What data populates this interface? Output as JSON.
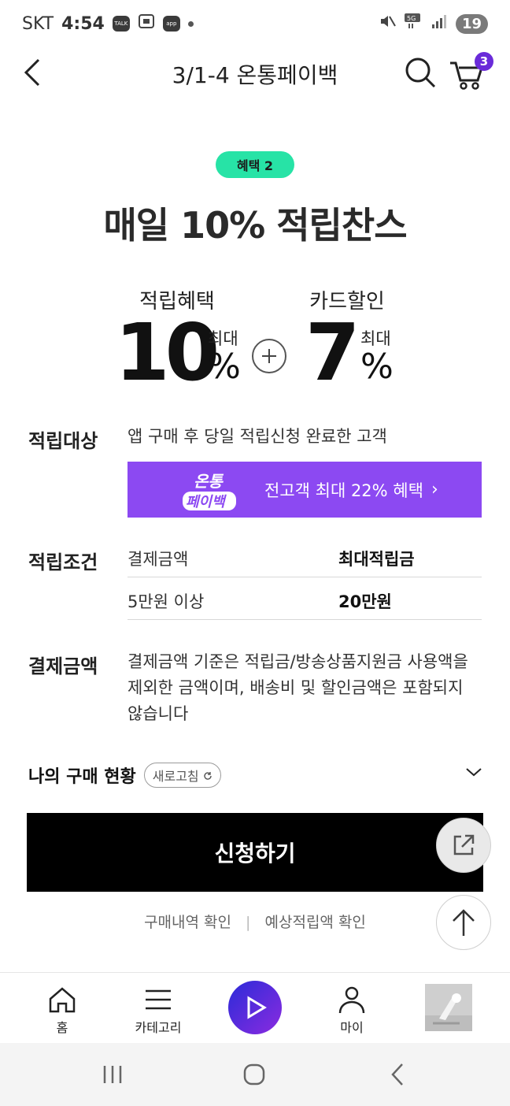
{
  "status_bar": {
    "carrier": "SKT",
    "time": "4:54",
    "icons": [
      "talk-icon",
      "screenshot-icon",
      "app-icon",
      "notification-dot",
      "mute-icon",
      "5g-icon",
      "signal-icon"
    ],
    "battery": "19"
  },
  "header": {
    "title": "3/1-4 온통페이백",
    "cart_count": "3"
  },
  "benefit": {
    "tag": "혜택 2",
    "headline": "매일 10% 적립찬스",
    "left": {
      "label": "적립혜택",
      "number": "10",
      "max": "최대",
      "unit": "%"
    },
    "right": {
      "label": "카드할인",
      "number": "7",
      "max": "최대",
      "unit": "%"
    }
  },
  "target": {
    "title": "적립대상",
    "text": "앱 구매 후 당일 적립신청 완료한 고객"
  },
  "promo": {
    "logo_line1": "온통",
    "logo_line2": "페이백",
    "text": "전고객 최대 22% 혜택",
    "chevron": "›",
    "color": "#8c49f2"
  },
  "conditions": {
    "title": "적립조건",
    "headers": [
      "결제금액",
      "최대적립금"
    ],
    "rows": [
      [
        "5만원 이상",
        "20만원"
      ]
    ]
  },
  "payment": {
    "title": "결제금액",
    "lines": [
      "결제금액 기준은 적립금/방송상품지원금 사용액을",
      "제외한 금액이며, 배송비 및 할인금액은 포함되지",
      "않습니다"
    ]
  },
  "purchase_status": {
    "title": "나의 구매 현황",
    "refresh": "새로고침"
  },
  "apply_button": "신청하기",
  "links": [
    "구매내역 확인",
    "예상적립액 확인"
  ],
  "bottom_nav": {
    "home": "홈",
    "category": "카테고리",
    "my": "마이"
  },
  "colors": {
    "accent": "#6a2bd9",
    "tag_green": "#27e3a6"
  }
}
